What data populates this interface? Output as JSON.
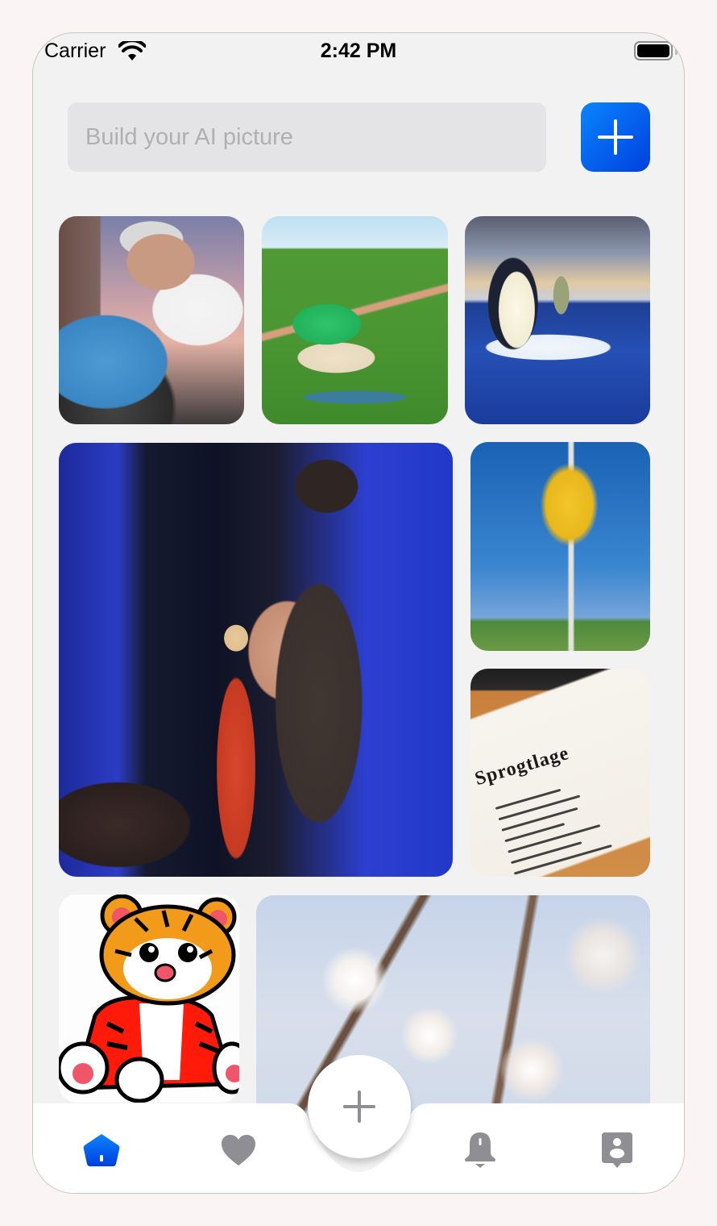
{
  "status_bar": {
    "carrier": "Carrier",
    "time": "2:42 PM",
    "wifi_icon": "wifi-icon",
    "battery_icon": "battery-full-icon"
  },
  "search": {
    "placeholder": "Build your AI picture",
    "value": ""
  },
  "add_button": {
    "icon": "plus-icon",
    "color_start": "#0a84ff",
    "color_end": "#0040dd"
  },
  "gallery": {
    "images": [
      {
        "id": "mechanic",
        "description": "Man in white cap and t-shirt inspecting a blue car wheel in front of a brick tower"
      },
      {
        "id": "yoga",
        "description": "Woman in green tank top doing a side stretch on a yoga mat on grass"
      },
      {
        "id": "penguin",
        "description": "Penguin on an ice floe catching a fish over the ocean"
      },
      {
        "id": "runway",
        "description": "Woman in a sequined dress walking a runway with blue lighting"
      },
      {
        "id": "tree",
        "description": "Yellow-flowered tree against a blue sky in a field"
      },
      {
        "id": "notes",
        "description": "Handwritten notes document on a desk next to a keyboard",
        "heading_text": "Sprogtlage"
      },
      {
        "id": "tiger",
        "description": "Cartoon tiger cub sitting"
      },
      {
        "id": "blossom",
        "description": "White cherry blossom branches against a pale blue sky"
      }
    ]
  },
  "tab_bar": {
    "active_color": "#0a6cf5",
    "inactive_color": "#8e8e93",
    "items": [
      {
        "name": "home",
        "icon": "home-icon",
        "active": true
      },
      {
        "name": "favorites",
        "icon": "heart-icon",
        "active": false
      },
      {
        "name": "create",
        "icon": "plus-icon",
        "active": false
      },
      {
        "name": "notifications",
        "icon": "bell-icon",
        "active": false
      },
      {
        "name": "profile",
        "icon": "profile-icon",
        "active": false
      }
    ]
  }
}
